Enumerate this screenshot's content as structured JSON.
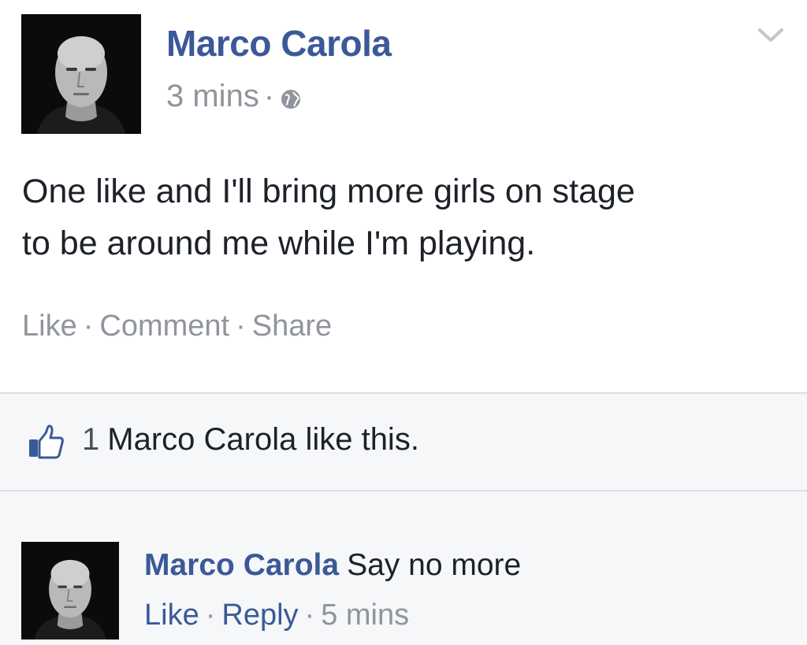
{
  "post": {
    "author": "Marco Carola",
    "time": "3 mins",
    "separator": "·",
    "audience_icon": "globe-icon",
    "menu_icon": "chevron-down-icon",
    "text_lines": [
      "One like and I'll bring more girls on stage",
      "to be around me while I'm playing."
    ],
    "actions": {
      "like": "Like",
      "comment": "Comment",
      "share": "Share",
      "separator": "·"
    }
  },
  "likes": {
    "icon": "thumbs-up-icon",
    "count": "1",
    "text": "Marco Carola like this."
  },
  "comment": {
    "author": "Marco Carola",
    "text": "Say no more",
    "actions": {
      "like": "Like",
      "reply": "Reply",
      "time": "5 mins",
      "separator": "·"
    }
  },
  "colors": {
    "name_blue": "#3b5998",
    "meta_gray": "#90949c",
    "text_dark": "#1d2129",
    "panel_bg": "#f6f7f9",
    "divider": "#dddfe2"
  }
}
